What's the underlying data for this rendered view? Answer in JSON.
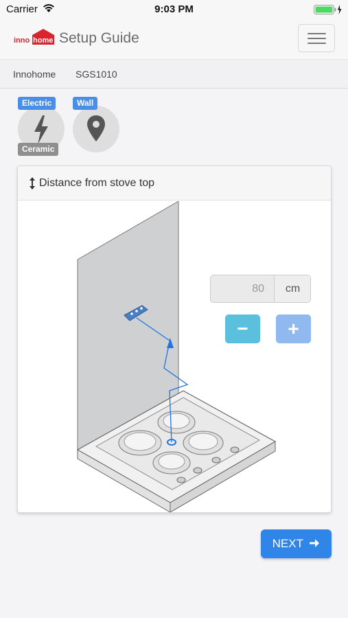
{
  "status_bar": {
    "carrier": "Carrier",
    "time": "9:03 PM"
  },
  "navbar": {
    "logo_text_1": "inno",
    "logo_text_2": "home",
    "title": "Setup Guide"
  },
  "breadcrumb": {
    "brand": "Innohome",
    "model": "SGS1010"
  },
  "badges": {
    "power": {
      "top_label": "Electric",
      "bottom_label": "Ceramic",
      "icon": "lightning-icon"
    },
    "placement": {
      "top_label": "Wall",
      "icon": "map-pin-icon"
    }
  },
  "card": {
    "title": "Distance from stove top",
    "icon": "vertical-arrows-icon",
    "distance_value": "80",
    "distance_unit": "cm",
    "minus_label": "−",
    "plus_label": "+"
  },
  "next_button": {
    "label": "NEXT"
  },
  "colors": {
    "primary": "#2f86e8",
    "info": "#5bc0de",
    "tag_blue": "#4a8fe7",
    "tag_gray": "#8f8f8f",
    "brand_red": "#d9232d"
  }
}
